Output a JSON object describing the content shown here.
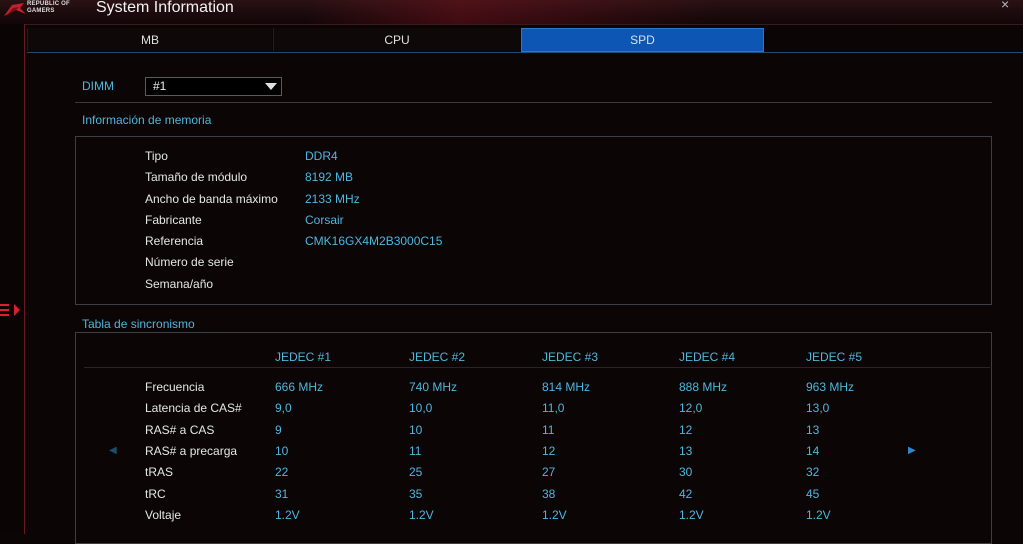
{
  "app": {
    "brand": "REPUBLIC OF GAMERS",
    "brand_line1": "REPUBLIC OF",
    "brand_line2": "GAMERS",
    "title": "System Information",
    "close": "×"
  },
  "tabs": [
    {
      "label": "MB",
      "active": false
    },
    {
      "label": "CPU",
      "active": false
    },
    {
      "label": "SPD",
      "active": true
    }
  ],
  "dimm": {
    "label": "DIMM",
    "selected": "#1"
  },
  "memory_info": {
    "title": "Información de memoria",
    "rows": [
      {
        "label": "Tipo",
        "value": "DDR4"
      },
      {
        "label": "Tamaño de módulo",
        "value": "8192 MB"
      },
      {
        "label": "Ancho de banda máximo",
        "value": "2133 MHz"
      },
      {
        "label": "Fabricante",
        "value": "Corsair"
      },
      {
        "label": "Referencia",
        "value": "CMK16GX4M2B3000C15"
      },
      {
        "label": "Número de serie",
        "value": ""
      },
      {
        "label": "Semana/año",
        "value": ""
      }
    ]
  },
  "timing": {
    "title": "Tabla de sincronismo",
    "columns": [
      "JEDEC #1",
      "JEDEC #2",
      "JEDEC #3",
      "JEDEC #4",
      "JEDEC #5"
    ],
    "rows": [
      {
        "label": "Frecuencia",
        "values": [
          "666 MHz",
          "740 MHz",
          "814 MHz",
          "888 MHz",
          "963 MHz"
        ]
      },
      {
        "label": "Latencia de CAS#",
        "values": [
          "9,0",
          "10,0",
          "11,0",
          "12,0",
          "13,0"
        ]
      },
      {
        "label": "RAS# a CAS",
        "values": [
          "9",
          "10",
          "11",
          "12",
          "13"
        ]
      },
      {
        "label": "RAS# a precarga",
        "values": [
          "10",
          "11",
          "12",
          "13",
          "14"
        ]
      },
      {
        "label": "tRAS",
        "values": [
          "22",
          "25",
          "27",
          "30",
          "32"
        ]
      },
      {
        "label": "tRC",
        "values": [
          "31",
          "35",
          "38",
          "42",
          "45"
        ]
      },
      {
        "label": "Voltaje",
        "values": [
          "1.2V",
          "1.2V",
          "1.2V",
          "1.2V",
          "1.2V"
        ]
      }
    ],
    "prev_arrow": "◀",
    "next_arrow": "▶"
  },
  "colors": {
    "accent": "#4fb6dd",
    "active_tab": "#0d56b3",
    "brand_red": "#c4202e"
  }
}
